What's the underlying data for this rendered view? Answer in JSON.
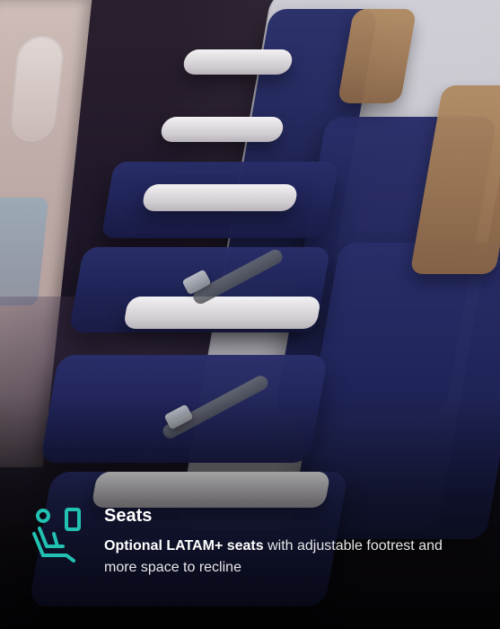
{
  "feature": {
    "icon": "seat-icon",
    "title": "Seats",
    "desc_bold": "Optional LATAM+ seats",
    "desc_rest": " with adjustable footrest and more space to recline"
  },
  "colors": {
    "icon_accent": "#22c2b3"
  }
}
